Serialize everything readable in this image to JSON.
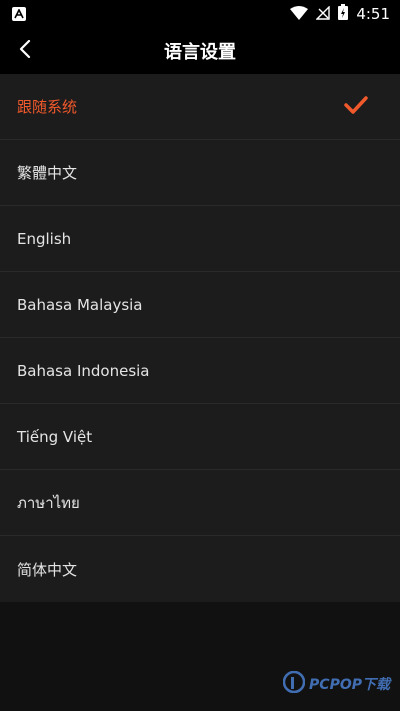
{
  "status_bar": {
    "time": "4:51",
    "icons": [
      "app-a-icon",
      "wifi-icon",
      "no-signal-icon",
      "battery-charging-icon"
    ]
  },
  "header": {
    "title": "语言设置",
    "back_icon": "chevron-left-icon"
  },
  "languages": [
    {
      "label": "跟随系统",
      "selected": true
    },
    {
      "label": "繁體中文",
      "selected": false
    },
    {
      "label": "English",
      "selected": false
    },
    {
      "label": "Bahasa Malaysia",
      "selected": false
    },
    {
      "label": "Bahasa Indonesia",
      "selected": false
    },
    {
      "label": "Tiếng Việt",
      "selected": false
    },
    {
      "label": "ภาษาไทย",
      "selected": false
    },
    {
      "label": "简体中文",
      "selected": false
    }
  ],
  "colors": {
    "accent": "#f0592b",
    "background": "#111111",
    "list_background": "#1c1c1c"
  },
  "watermark": {
    "text": "PCPOP下载"
  }
}
